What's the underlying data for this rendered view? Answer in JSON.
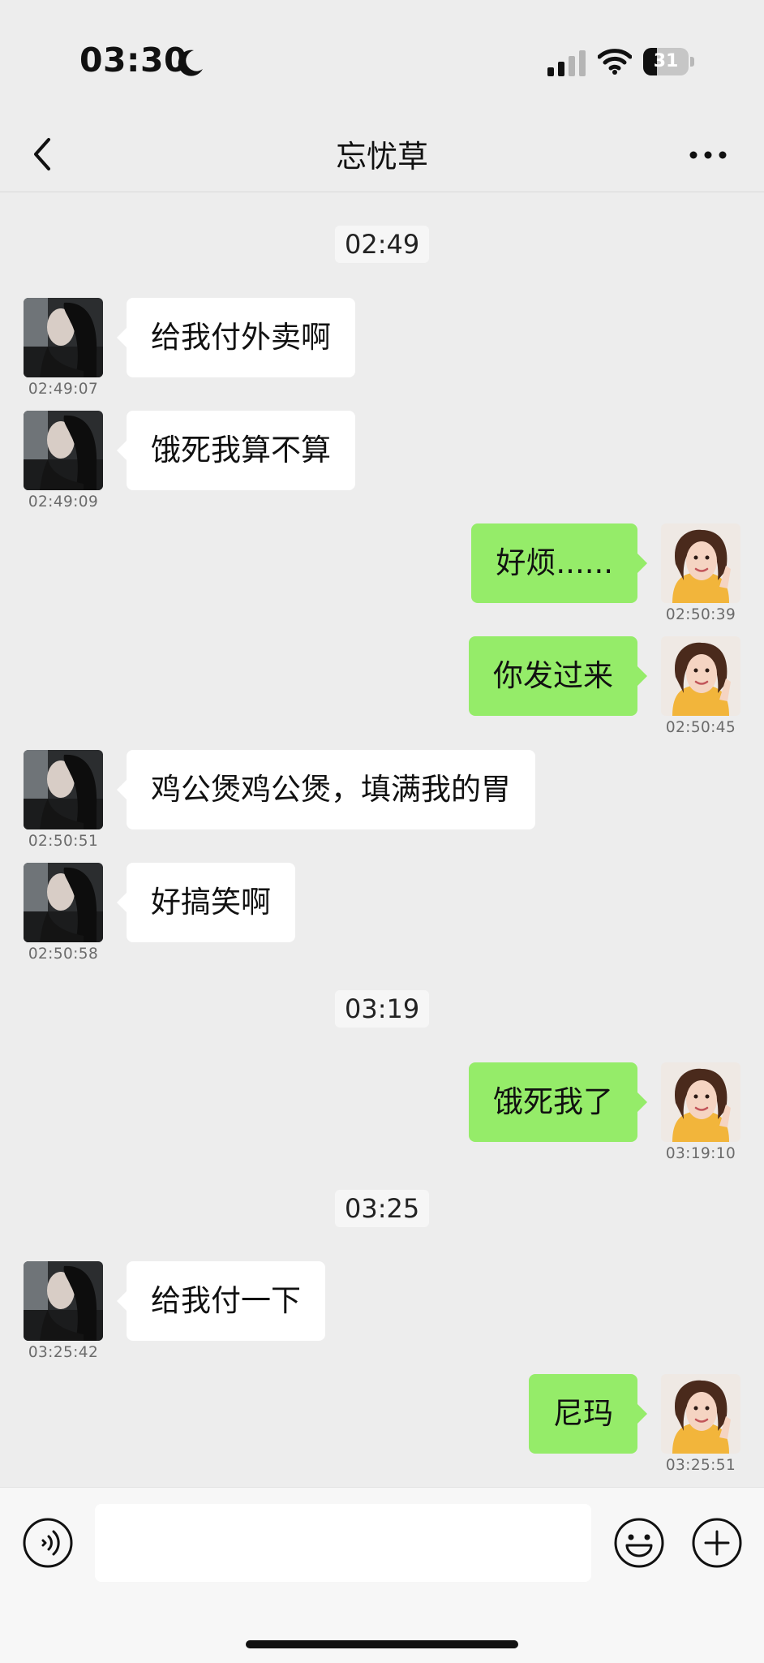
{
  "status_bar": {
    "time": "03:30",
    "battery": "31",
    "battery_level": 0.31
  },
  "header": {
    "title": "忘忧草"
  },
  "icons": {
    "back": "chevron-left-icon",
    "more": "more-dots-icon",
    "moon": "moon-icon",
    "signal": "cellular-signal-icon",
    "wifi": "wifi-icon",
    "battery": "battery-icon",
    "voice": "voice-icon",
    "emoji": "emoji-icon",
    "plus": "plus-icon"
  },
  "colors": {
    "incoming_bubble": "#ffffff",
    "outgoing_bubble": "#95ec69",
    "background": "#ededed"
  },
  "chat": {
    "dividers": [
      "02:49",
      "03:19",
      "03:25"
    ],
    "messages": [
      {
        "side": "in",
        "text": "给我付外卖啊",
        "time": "02:49:07"
      },
      {
        "side": "in",
        "text": "饿死我算不算",
        "time": "02:49:09"
      },
      {
        "side": "out",
        "text": "好烦......",
        "time": "02:50:39"
      },
      {
        "side": "out",
        "text": "你发过来",
        "time": "02:50:45"
      },
      {
        "side": "in",
        "text": "鸡公煲鸡公煲，填满我的胃",
        "time": "02:50:51"
      },
      {
        "side": "in",
        "text": "好搞笑啊",
        "time": "02:50:58"
      },
      {
        "side": "out",
        "text": "饿死我了",
        "time": "03:19:10"
      },
      {
        "side": "in",
        "text": "给我付一下",
        "time": "03:25:42"
      },
      {
        "side": "out",
        "text": "尼玛",
        "time": "03:25:51"
      }
    ]
  },
  "input": {
    "value": "",
    "placeholder": ""
  }
}
